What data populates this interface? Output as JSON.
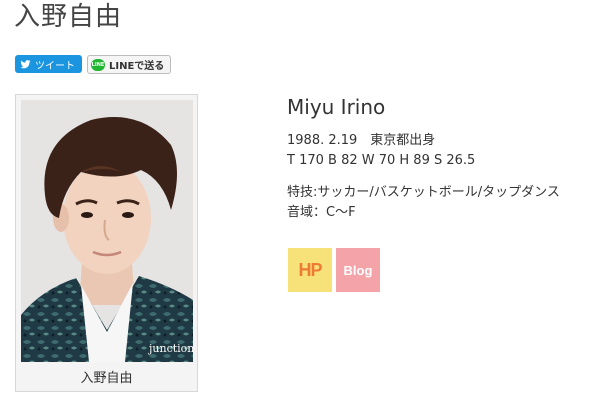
{
  "page": {
    "title": "入野自由"
  },
  "share": {
    "tweet_label": "ツイート",
    "line_label": "LINEで送る",
    "line_icon_text": "LINE"
  },
  "profile": {
    "photo_watermark": "junction",
    "caption": "入野自由",
    "name_en": "Miyu Irino",
    "birth": "1988. 2.19　東京都出身",
    "measurements": "T 170 B 82 W 70 H 89 S 26.5",
    "skills": "特技:サッカー/バスケットボール/タップダンス",
    "vocal_range": "音域：C～F"
  },
  "links": {
    "hp_label": "HP",
    "blog_label": "Blog"
  },
  "colors": {
    "tweet": "#1b95e0",
    "line": "#21b632",
    "hp_bg": "#f7e27a",
    "hp_text": "#ee7a33",
    "blog_bg": "#f4a3a8"
  },
  "icons": {
    "tweet": "twitter-bird-icon",
    "line": "line-icon"
  }
}
